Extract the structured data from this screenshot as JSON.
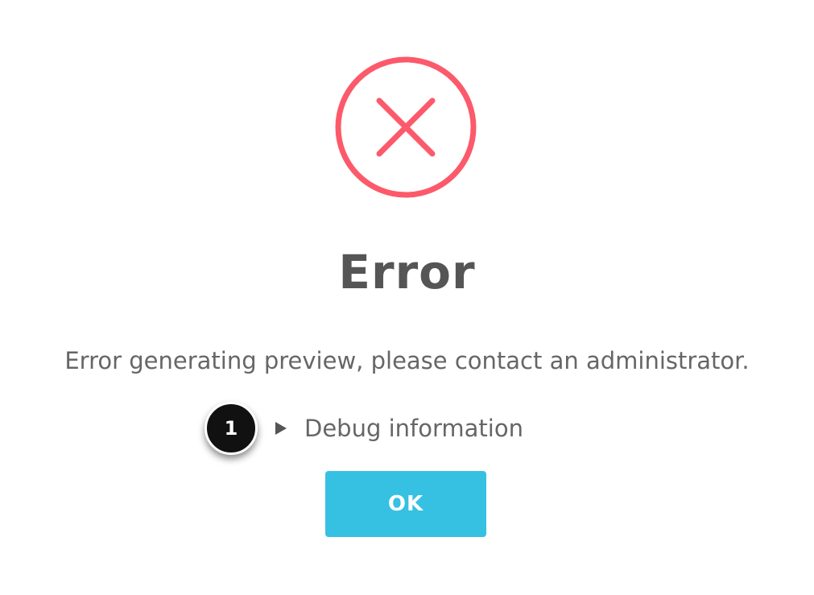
{
  "dialog": {
    "icon": "error-x-circle-icon",
    "title": "Error",
    "message": "Error generating preview, please contact an administrator.",
    "debug_toggle": {
      "icon": "disclosure-triangle-icon",
      "label": "Debug information",
      "expanded": false
    },
    "ok_label": "OK"
  },
  "annotation": {
    "callout_number": "1"
  },
  "colors": {
    "error_accent": "#fc5a6b",
    "title_text": "#555555",
    "body_text": "#666666",
    "button_bg": "#36c1e2",
    "button_text": "#ffffff",
    "callout_bg": "#111111"
  }
}
